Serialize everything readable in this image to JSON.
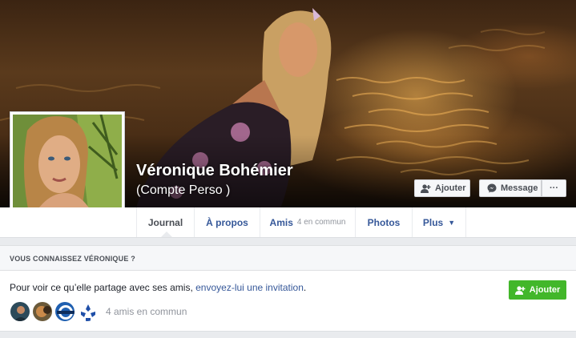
{
  "profile": {
    "name": "Véronique Bohémier",
    "alternate_name": "(Compte Perso )"
  },
  "cover_actions": {
    "add_friend_label": "Ajouter",
    "message_label": "Message",
    "more_label": "···"
  },
  "tabs": [
    {
      "label": "Journal",
      "active": true
    },
    {
      "label": "À propos"
    },
    {
      "label": "Amis",
      "sub": "4 en commun"
    },
    {
      "label": "Photos"
    },
    {
      "label": "Plus",
      "caret": "▼"
    }
  ],
  "know_card": {
    "title": "VOUS CONNAISSEZ VÉRONIQUE ?",
    "text_before": "Pour voir ce qu’elle partage avec ses amis, ",
    "link_text": "envoyez-lui une invitation",
    "text_after": ".",
    "button_label": "Ajouter",
    "mutual_friends": "4 amis en commun"
  },
  "colors": {
    "link": "#365899",
    "green": "#42b72a",
    "page_bg": "#e9ebee"
  }
}
